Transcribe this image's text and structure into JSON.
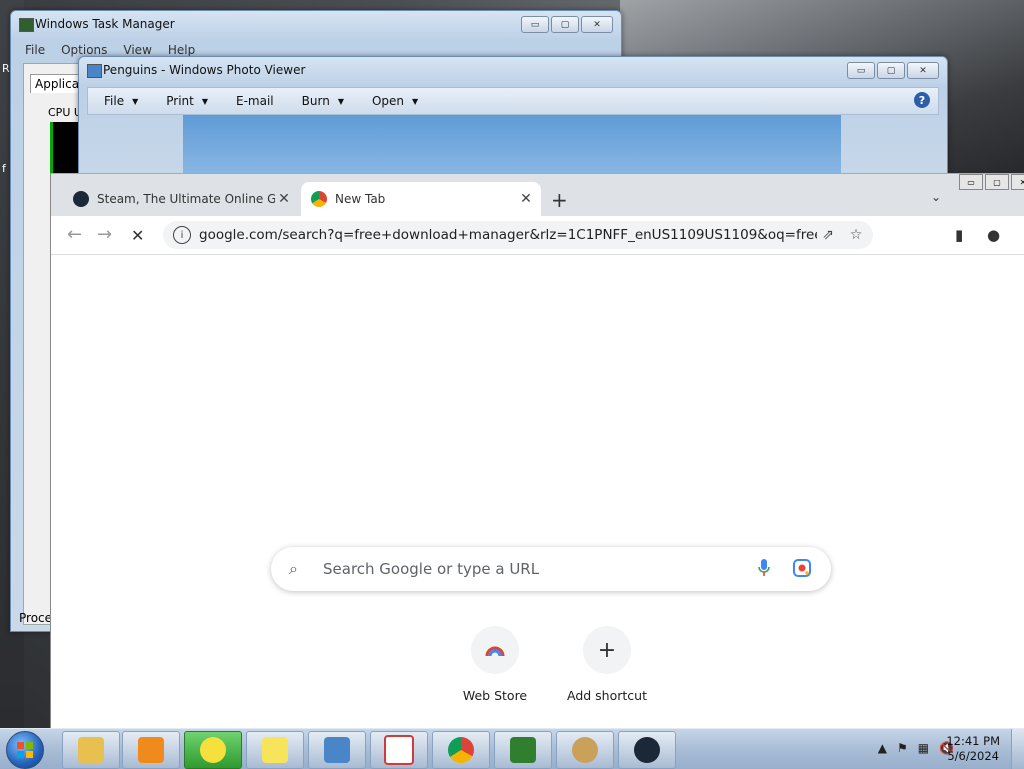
{
  "edge_chars": {
    "r": "R",
    "f": "f"
  },
  "task_manager": {
    "title": "Windows Task Manager",
    "menu": [
      "File",
      "Options",
      "View",
      "Help"
    ],
    "tab_label": "Applicatio",
    "cpu_label": "CPU U",
    "status_label": "Proce",
    "caption": {
      "min": "▭",
      "max": "▢",
      "close": "✕"
    }
  },
  "photo_viewer": {
    "title": "Penguins - Windows Photo Viewer",
    "menu": [
      {
        "label": "File",
        "dropdown": true
      },
      {
        "label": "Print",
        "dropdown": true
      },
      {
        "label": "E-mail",
        "dropdown": false
      },
      {
        "label": "Burn",
        "dropdown": true
      },
      {
        "label": "Open",
        "dropdown": true
      }
    ],
    "help": "?",
    "caption": {
      "min": "▭",
      "max": "▢",
      "close": "✕"
    }
  },
  "chrome": {
    "tabs": [
      {
        "title": "Steam, The Ultimate Online Game",
        "icon": "steam-icon",
        "active": false,
        "close": "✕"
      },
      {
        "title": "New Tab",
        "icon": "chrome-icon",
        "active": true,
        "close": "✕"
      }
    ],
    "new_tab": "+",
    "tab_search": "⌄",
    "nav": {
      "back": "←",
      "forward": "→",
      "stop": "✕"
    },
    "url": "google.com/search?q=free+download+manager&rlz=1C1PNFF_enUS1109US1109&oq=free+download+m...",
    "info": "i",
    "search_placeholder": "Search Google or type a URL",
    "shortcuts": [
      {
        "label": "Web Store",
        "icon": "web-store-icon"
      },
      {
        "label": "Add shortcut",
        "icon": "plus-icon",
        "glyph": "+"
      }
    ],
    "window_caps": {
      "min": "▭",
      "max": "▢",
      "close": "✕"
    }
  },
  "taskbar": {
    "apps": [
      {
        "name": "Windows Explorer",
        "icon": "explorer-icon",
        "color": "#e8c050"
      },
      {
        "name": "Media Player",
        "icon": "media-player-icon",
        "color": "#f08a1c"
      },
      {
        "name": "Game (green)",
        "icon": "green-plus-icon",
        "color": "#f5e03c"
      },
      {
        "name": "Sticky Notes",
        "icon": "sticky-notes-icon",
        "color": "#f8e45a"
      },
      {
        "name": "Photo Viewer",
        "icon": "photo-viewer-icon",
        "color": "#4a86c7"
      },
      {
        "name": "Snipping Tool",
        "icon": "snipping-tool-icon",
        "color": "#d23b3b"
      },
      {
        "name": "Google Chrome",
        "icon": "chrome-icon",
        "color": "#db4437"
      },
      {
        "name": "Task Manager",
        "icon": "task-manager-icon",
        "color": "#2f7f2f"
      },
      {
        "name": "Compass App",
        "icon": "compass-icon",
        "color": "#c9a15a"
      },
      {
        "name": "Steam",
        "icon": "steam-icon",
        "color": "#1b2838"
      }
    ],
    "tray": {
      "arrow": "▲",
      "flag": "⚑",
      "network": "▦",
      "volume": "🔇"
    },
    "clock_time": "12:41 PM",
    "clock_date": "5/6/2024"
  }
}
